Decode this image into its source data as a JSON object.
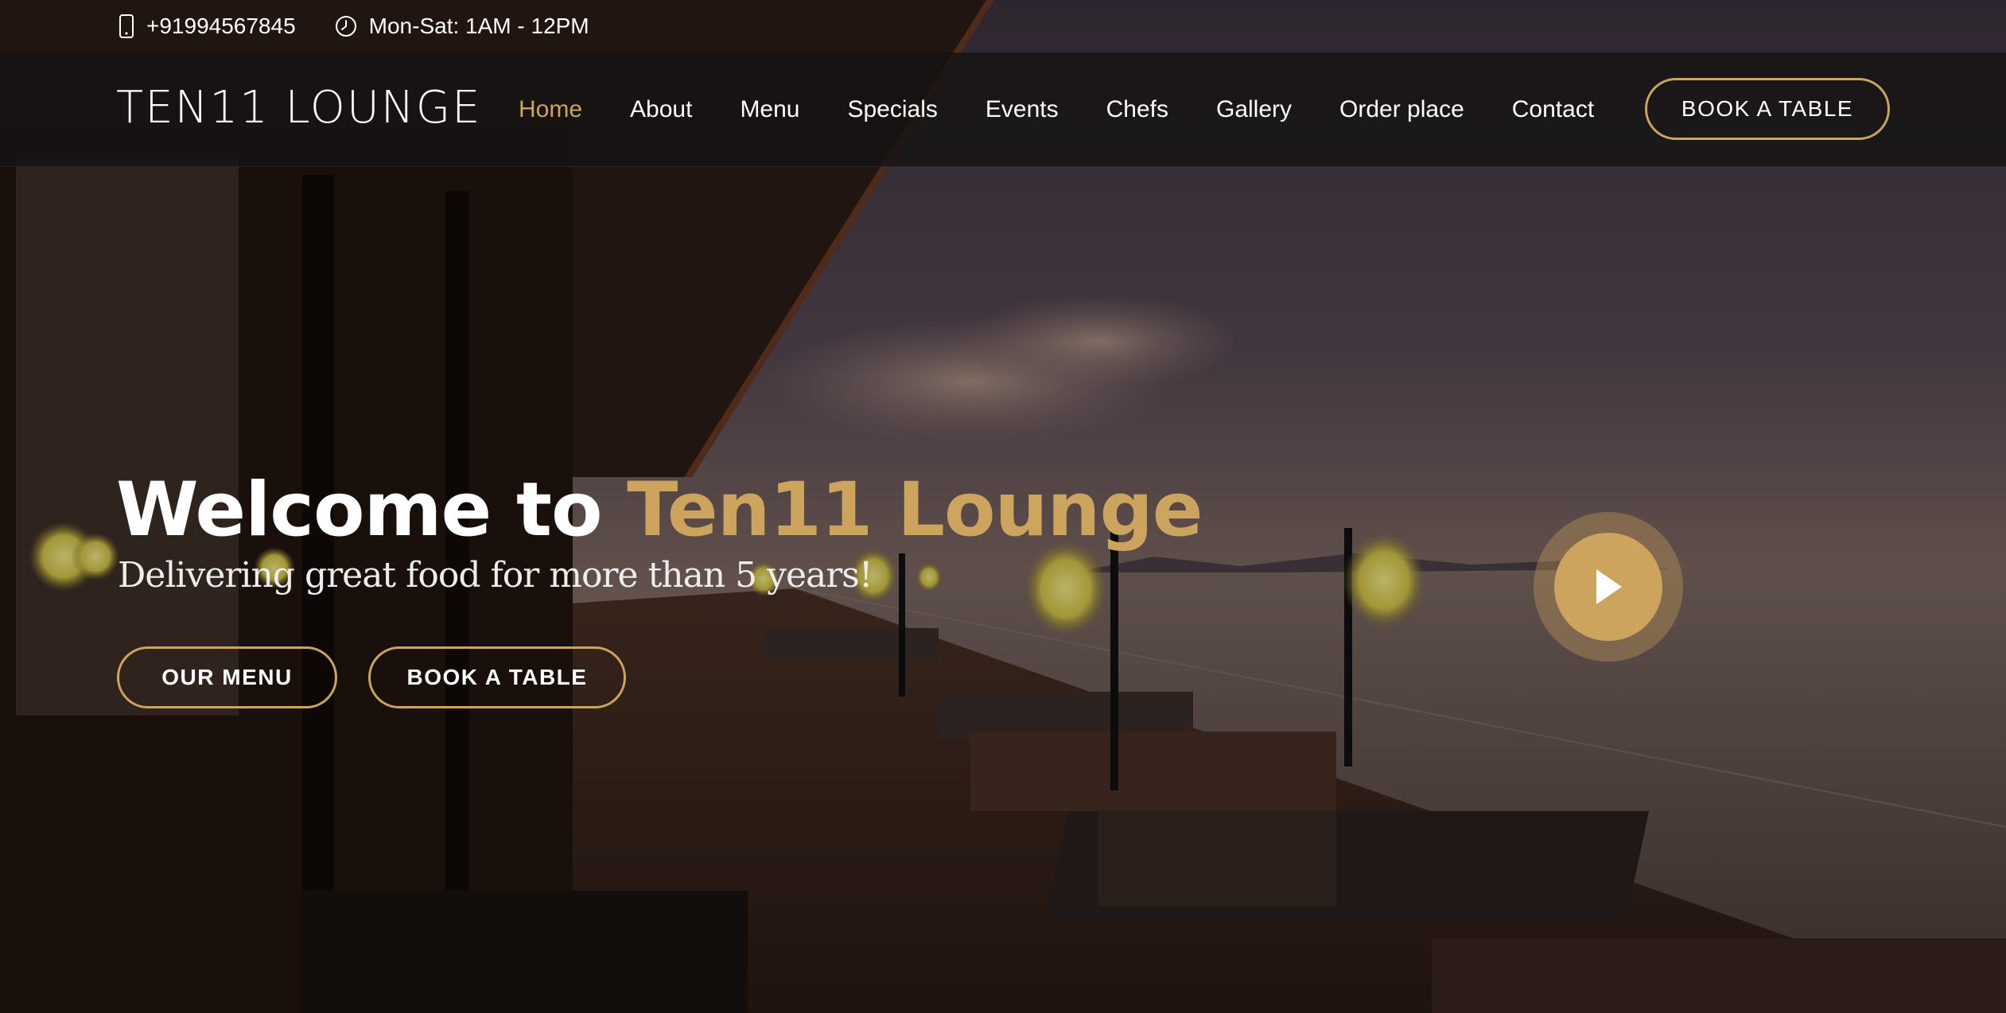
{
  "topbar": {
    "phone": "+91994567845",
    "hours": "Mon-Sat: 1AM - 12PM",
    "phone_icon": "smartphone-icon",
    "hours_icon": "clock-icon"
  },
  "header": {
    "logo": "TEN11 LOUNGE",
    "nav": [
      {
        "label": "Home",
        "active": true
      },
      {
        "label": "About"
      },
      {
        "label": "Menu"
      },
      {
        "label": "Specials"
      },
      {
        "label": "Events"
      },
      {
        "label": "Chefs"
      },
      {
        "label": "Gallery"
      },
      {
        "label": "Order place"
      },
      {
        "label": "Contact"
      }
    ],
    "book_label": "BOOK A TABLE"
  },
  "hero": {
    "title_prefix": "Welcome to ",
    "title_accent": "Ten11 Lounge",
    "subtitle": "Delivering great food for more than 5 years!",
    "menu_button": "OUR MENU",
    "book_button": "BOOK A TABLE",
    "play_icon": "play-icon"
  },
  "colors": {
    "accent": "#cda45e",
    "header_bg": "#161413",
    "text": "#ffffff"
  }
}
